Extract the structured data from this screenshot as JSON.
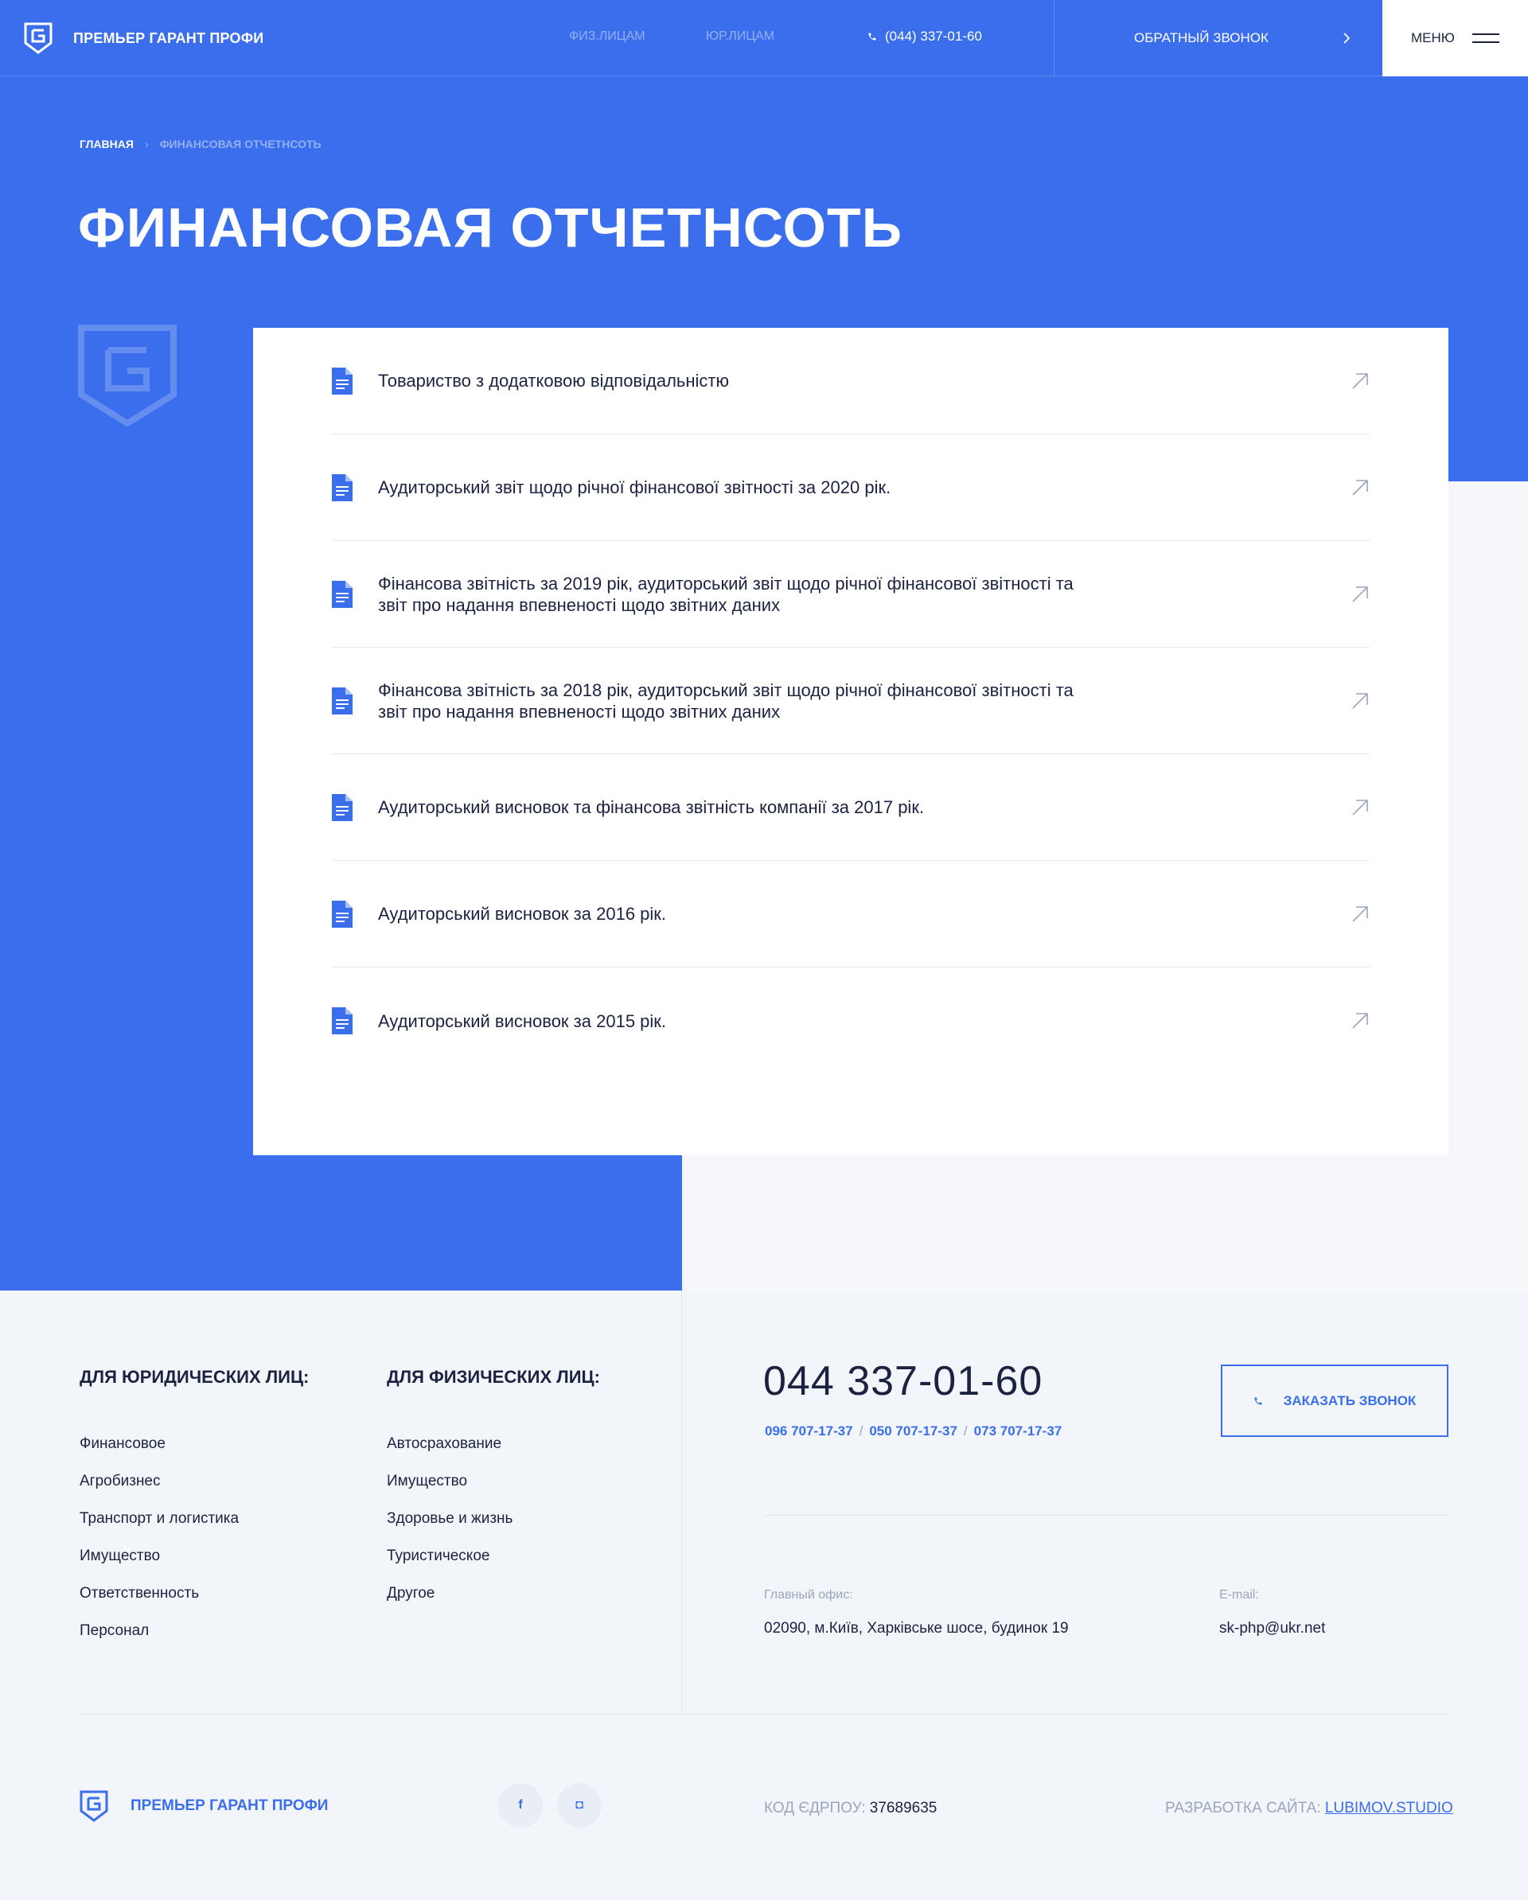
{
  "header": {
    "brand": "ПРЕМЬЕР ГАРАНТ ПРОФИ",
    "nav": {
      "individuals": "ФИЗ.ЛИЦАМ",
      "companies": "ЮР.ЛИЦАМ"
    },
    "phone": "(044) 337-01-60",
    "callback": "ОБРАТНЫЙ ЗВОНОК",
    "menu": "МЕНЮ"
  },
  "breadcrumb": {
    "home": "ГЛАВНАЯ",
    "separator": "›",
    "current": "ФИНАНСОВАЯ ОТЧЕТНСОТЬ"
  },
  "page_title": "ФИНАНСОВАЯ ОТЧЕТНСОТЬ",
  "documents": [
    {
      "title": "Товариство з додатковою відповідальністю"
    },
    {
      "title": "Аудиторський звіт щодо річної фінансової звітності за 2020 рік."
    },
    {
      "title": "Фінансова звітність за 2019 рік, аудиторський звіт щодо річної фінансової звітності та звіт про надання впевненості щодо звітних даних"
    },
    {
      "title": "Фінансова звітність за 2018 рік, аудиторський звіт щодо річної фінансової звітності та звіт про надання впевненості щодо звітних даних"
    },
    {
      "title": "Аудиторський висновок та фінансова звітність компанії за 2017 рік."
    },
    {
      "title": "Аудиторський висновок за 2016 рік."
    },
    {
      "title": "Аудиторський висновок за 2015 рік."
    }
  ],
  "footer": {
    "legal": {
      "title": "ДЛЯ ЮРИДИЧЕСКИХ ЛИЦ:",
      "items": [
        "Финансовое",
        "Агробизнес",
        "Транспорт и логистика",
        "Имущество",
        "Ответственность",
        "Персонал"
      ]
    },
    "personal": {
      "title": "ДЛЯ ФИЗИЧЕСКИХ ЛИЦ:",
      "items": [
        "Автосрахование",
        "Имущество",
        "Здоровье и жизнь",
        "Туристическое",
        "Другое"
      ]
    },
    "main_phone": "044 337-01-60",
    "phones": [
      "096 707-17-37",
      "050 707-17-37",
      "073 707-17-37"
    ],
    "phone_separator": "/",
    "order_call": "ЗАКАЗАТЬ ЗВОНОК",
    "office_label": "Главный офис:",
    "office_value": "02090, м.Київ, Харківське шосе, будинок 19",
    "email_label": "E-mail:",
    "email_value": "sk-php@ukr.net",
    "brand": "ПРЕМЬЕР ГАРАНТ ПРОФИ",
    "social": {
      "facebook": "f",
      "instagram": "◘"
    },
    "edrpou_label": "КОД ЄДРПОУ:",
    "edrpou_value": "37689635",
    "dev_label": "РАЗРАБОТКА САЙТА:",
    "dev_link": "LUBIMOV.STUDIO"
  },
  "colors": {
    "accent": "#3a6eec",
    "text": "#1b2340",
    "muted": "#9aa6bd"
  },
  "icons": [
    "logo-shield-icon",
    "phone-icon",
    "chevron-right-icon",
    "burger-icon",
    "document-icon",
    "arrow-up-right-icon",
    "facebook-icon",
    "instagram-icon"
  ]
}
